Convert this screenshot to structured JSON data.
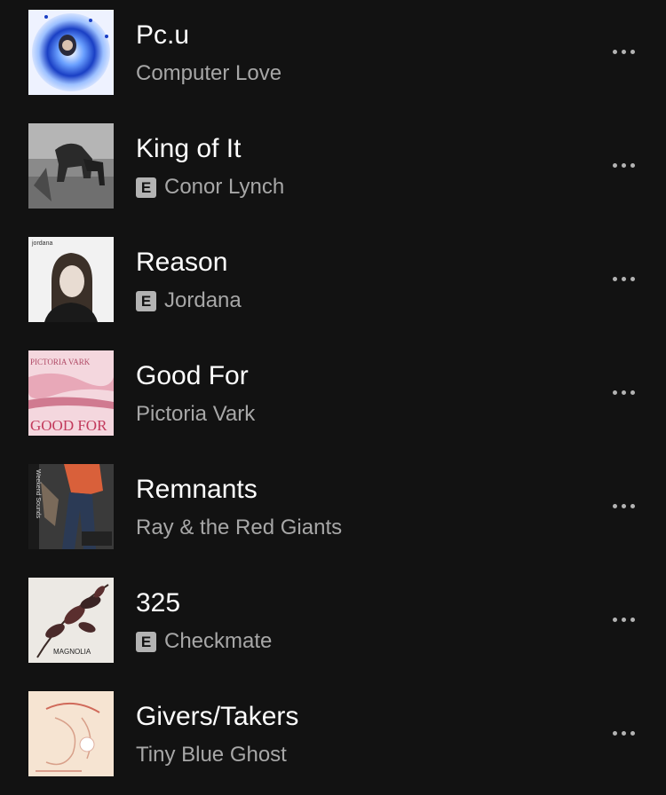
{
  "tracks": [
    {
      "title": "Pc.u",
      "artist": "Computer Love",
      "explicit": false,
      "explicit_label": "",
      "cover_icon": "album-cover-pcu"
    },
    {
      "title": "King of It",
      "artist": "Conor Lynch",
      "explicit": true,
      "explicit_label": "E",
      "cover_icon": "album-cover-king-of-it"
    },
    {
      "title": "Reason",
      "artist": "Jordana",
      "explicit": true,
      "explicit_label": "E",
      "cover_icon": "album-cover-reason",
      "cover_text": "jordana"
    },
    {
      "title": "Good For",
      "artist": "Pictoria Vark",
      "explicit": false,
      "explicit_label": "",
      "cover_icon": "album-cover-good-for",
      "cover_text": "GOOD FOR",
      "cover_text_top": "PICTORIA VARK"
    },
    {
      "title": "Remnants",
      "artist": "Ray & the Red Giants",
      "explicit": false,
      "explicit_label": "",
      "cover_icon": "album-cover-remnants",
      "cover_text": "Weekend Sounds"
    },
    {
      "title": "325",
      "artist": "Checkmate",
      "explicit": true,
      "explicit_label": "E",
      "cover_icon": "album-cover-325",
      "cover_text": "MAGNOLIA"
    },
    {
      "title": "Givers/Takers",
      "artist": "Tiny Blue Ghost",
      "explicit": false,
      "explicit_label": "",
      "cover_icon": "album-cover-givers-takers"
    }
  ],
  "colors": {
    "background": "#121212",
    "title": "#ffffff",
    "artist": "#a7a7a7",
    "explicit_badge": "#b3b3b3",
    "more_dots": "#b3b3b3"
  },
  "icons": {
    "more": "more-options-icon",
    "explicit": "explicit-badge"
  }
}
